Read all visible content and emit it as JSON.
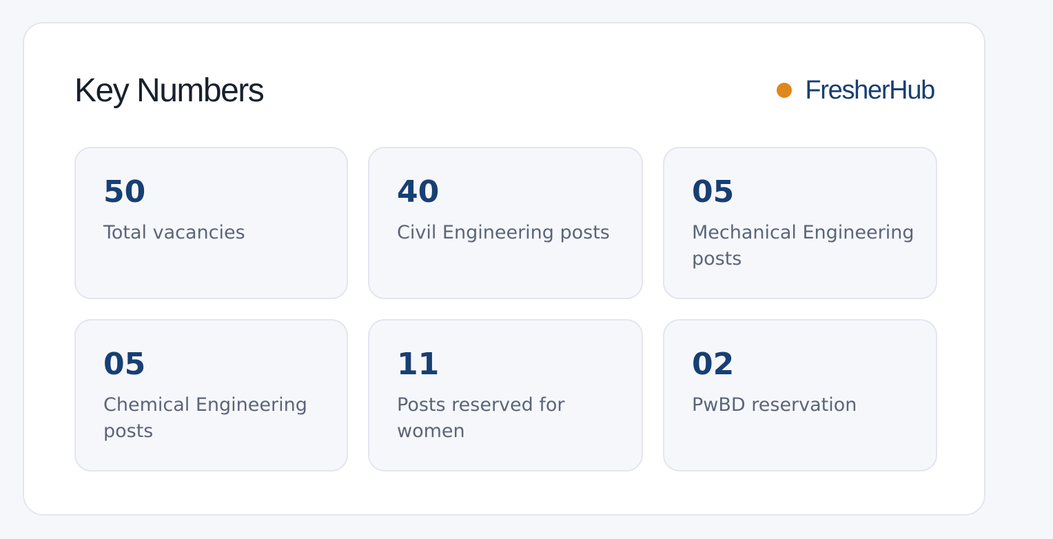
{
  "panel": {
    "title": "Key Numbers",
    "brand": {
      "name": "FresherHub",
      "dot_color": "#e0871a",
      "name_color": "#173f73"
    }
  },
  "theme": {
    "number_color": "#173f73"
  },
  "stats": [
    {
      "value": "50",
      "label": "Total vacancies"
    },
    {
      "value": "40",
      "label": "Civil Engineering posts"
    },
    {
      "value": "05",
      "label": "Mechanical Engineering posts"
    },
    {
      "value": "05",
      "label": "Chemical Engineering posts"
    },
    {
      "value": "11",
      "label": "Posts reserved for women"
    },
    {
      "value": "02",
      "label": "PwBD reservation"
    }
  ]
}
